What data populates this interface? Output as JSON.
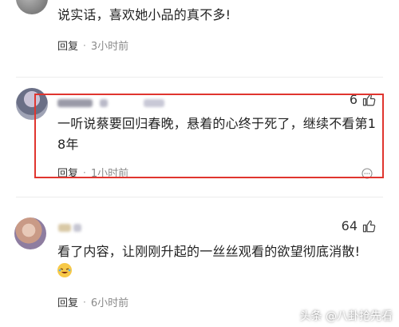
{
  "comments": [
    {
      "text": "说实话，喜欢她小品的真不多!",
      "reply_label": "回复",
      "time": "3小时前"
    },
    {
      "text_line1": "一听说蔡要回归春晚，悬着的心终于死了，继续不看第1",
      "text_line2": "8年",
      "likes": "6",
      "reply_label": "回复",
      "time": "1小时前"
    },
    {
      "text": "看了内容，让刚刚升起的一丝丝观看的欲望彻底消散!",
      "likes": "64",
      "reply_label": "回复",
      "time": "6小时前"
    }
  ],
  "watermark": {
    "text": "头条 @八卦抢先看"
  },
  "colors": {
    "highlight": "#e0352f",
    "time": "#8a8a8a"
  }
}
